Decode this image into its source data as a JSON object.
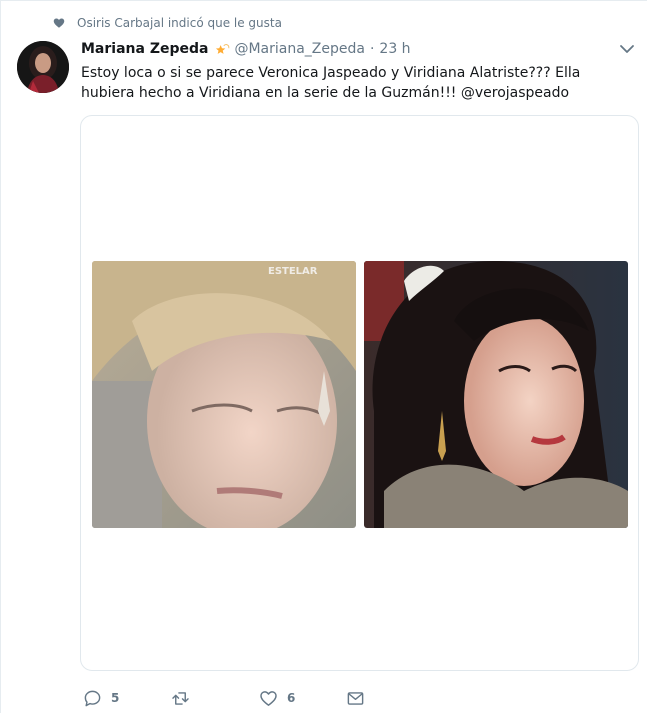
{
  "social_context": {
    "text": "Osiris Carbajal indicó que le gusta",
    "icon": "heart-icon"
  },
  "tweet": {
    "fullname": "Mariana Zepeda",
    "badge_icon": "star-emoji-icon",
    "screen_name": "@Mariana_Zepeda",
    "separator": "·",
    "time": "23 h",
    "menu_icon": "chevron-down-icon",
    "text": "Estoy loca o si se parece Veronica Jaspeado y Viridiana Alatriste??? Ella hubiera hecho a Viridiana en la serie de la Guzmán!!! ",
    "mention": "@verojaspeado"
  },
  "media": {
    "left_photo_caption": "ESTELAR"
  },
  "actions": {
    "reply_count": "5",
    "retweet_count": "",
    "like_count": "6"
  },
  "colors": {
    "secondary_text": "#657786",
    "border": "#e1e8ed",
    "primary_text": "#14171a"
  }
}
